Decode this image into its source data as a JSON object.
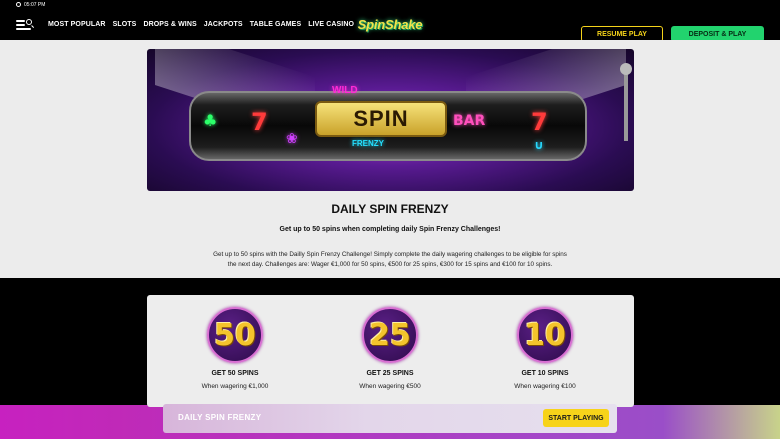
{
  "statusbar": {
    "time": "05:07 PM"
  },
  "header": {
    "nav": [
      "MOST POPULAR",
      "SLOTS",
      "DROPS & WINS",
      "JACKPOTS",
      "TABLE GAMES",
      "LIVE CASINO"
    ],
    "logo_text": "SpinShake",
    "resume_label": "RESUME PLAY",
    "deposit_label": "DEPOSIT & PLAY"
  },
  "hero": {
    "title_word": "SPIN",
    "top_word": "WILD",
    "bottom_word": "FRENZY",
    "reel_symbols": [
      "7",
      "7",
      "BAR",
      "7"
    ]
  },
  "promo": {
    "title": "DAILY SPIN FRENZY",
    "subtitle": "Get up to 50 spins when completing daily Spin Frenzy Challenges!",
    "description": "Get up to 50 spins with the Dailly Spin Frenzy Challenge! Simply complete the daily wagering challenges to be eligible for spins the next day. Challenges are: Wager €1,000 for 50 spins, €500 for 25 spins, €300 for 15 spins and €100 for 10 spins."
  },
  "prizes": [
    {
      "number": "50",
      "title": "GET 50 SPINS",
      "condition": "When wagering €1,000"
    },
    {
      "number": "25",
      "title": "GET 25 SPINS",
      "condition": "When wagering €500"
    },
    {
      "number": "10",
      "title": "GET 10 SPINS",
      "condition": "When wagering €100"
    }
  ],
  "sticky": {
    "label": "DAILY SPIN FRENZY",
    "button": "START PLAYING"
  },
  "colors": {
    "accent_yellow": "#f5d31a",
    "deposit_green": "#22d36e",
    "brand_purple": "#5a1b93",
    "glow_pink": "#c721c0"
  }
}
